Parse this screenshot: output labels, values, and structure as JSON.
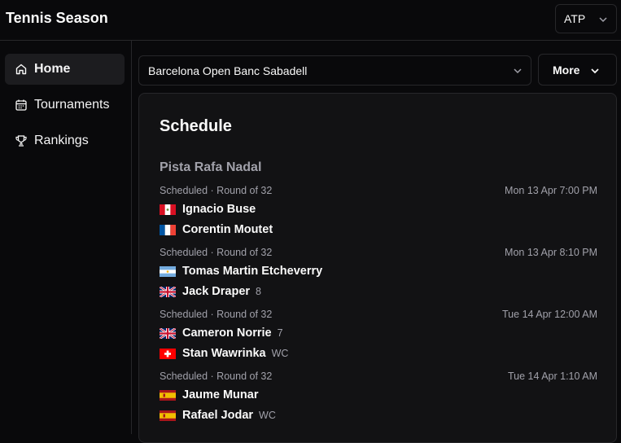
{
  "app": {
    "title": "Tennis Season"
  },
  "league_select": {
    "value": "ATP"
  },
  "sidebar": {
    "items": [
      {
        "label": "Home",
        "icon": "home-icon",
        "active": true
      },
      {
        "label": "Tournaments",
        "icon": "calendar-icon",
        "active": false
      },
      {
        "label": "Rankings",
        "icon": "trophy-icon",
        "active": false
      }
    ]
  },
  "tournament_select": {
    "value": "Barcelona Open Banc Sabadell"
  },
  "more_button": {
    "label": "More"
  },
  "schedule": {
    "title": "Schedule",
    "court": "Pista Rafa Nadal",
    "matches": [
      {
        "meta": "Scheduled · Round of 32",
        "time": "Mon 13 Apr 7:00 PM",
        "p1": {
          "name": "Ignacio Buse",
          "tag": "",
          "flag": "peru"
        },
        "p2": {
          "name": "Corentin Moutet",
          "tag": "",
          "flag": "france"
        }
      },
      {
        "meta": "Scheduled · Round of 32",
        "time": "Mon 13 Apr 8:10 PM",
        "p1": {
          "name": "Tomas Martin Etcheverry",
          "tag": "",
          "flag": "argentina"
        },
        "p2": {
          "name": "Jack Draper",
          "tag": "8",
          "flag": "uk"
        }
      },
      {
        "meta": "Scheduled · Round of 32",
        "time": "Tue 14 Apr 12:00 AM",
        "p1": {
          "name": "Cameron Norrie",
          "tag": "7",
          "flag": "uk"
        },
        "p2": {
          "name": "Stan Wawrinka",
          "tag": "WC",
          "flag": "switzerland"
        }
      },
      {
        "meta": "Scheduled · Round of 32",
        "time": "Tue 14 Apr 1:10 AM",
        "p1": {
          "name": "Jaume Munar",
          "tag": "",
          "flag": "spain"
        },
        "p2": {
          "name": "Rafael Jodar",
          "tag": "WC",
          "flag": "spain"
        }
      }
    ]
  }
}
